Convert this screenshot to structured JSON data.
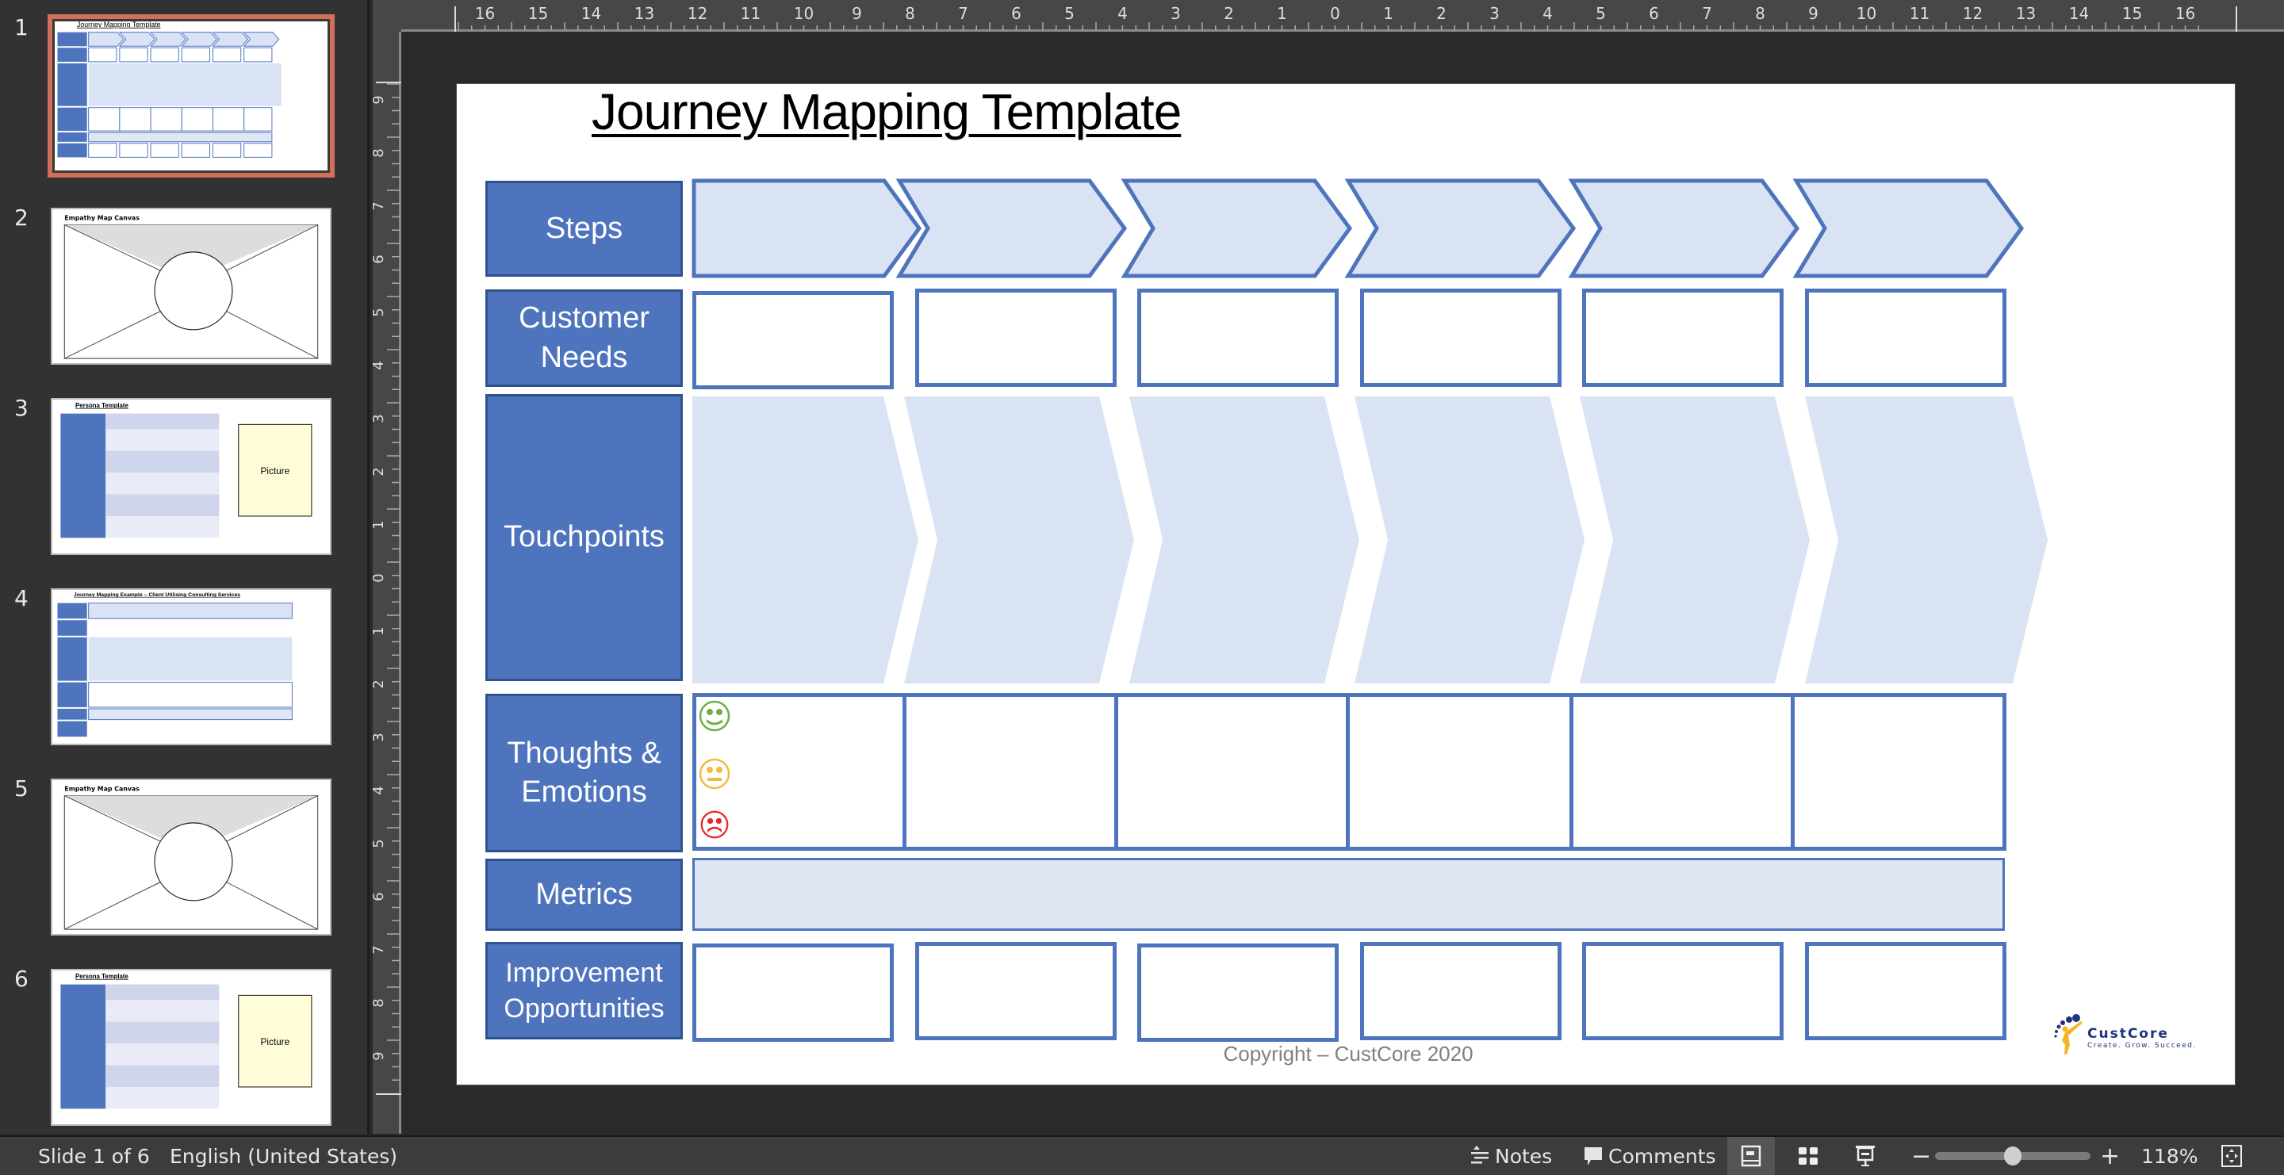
{
  "app": {
    "slide_count": 6,
    "current_slide": 1
  },
  "thumbnails": [
    {
      "number": "1",
      "title": "Journey Mapping Template",
      "selected": true
    },
    {
      "number": "2",
      "title": "Empathy Map Canvas",
      "selected": false
    },
    {
      "number": "3",
      "title": "Persona Template",
      "selected": false,
      "picture_label": "Picture"
    },
    {
      "number": "4",
      "title": "Journey Mapping Example – Client Utilising Consulting Services",
      "selected": false
    },
    {
      "number": "5",
      "title": "Empathy Map Canvas",
      "selected": false
    },
    {
      "number": "6",
      "title": "Persona Template",
      "selected": false,
      "picture_label": "Picture"
    }
  ],
  "ruler": {
    "horizontal_ticks": [
      "16",
      "15",
      "14",
      "13",
      "12",
      "11",
      "10",
      "9",
      "8",
      "7",
      "6",
      "5",
      "4",
      "3",
      "2",
      "1",
      "0",
      "1",
      "2",
      "3",
      "4",
      "5",
      "6",
      "7",
      "8",
      "9",
      "10",
      "11",
      "12",
      "13",
      "14",
      "15",
      "16"
    ],
    "vertical_ticks": [
      "9",
      "8",
      "7",
      "6",
      "5",
      "4",
      "3",
      "2",
      "1",
      "0",
      "1",
      "2",
      "3",
      "4",
      "5",
      "6",
      "7",
      "8",
      "9"
    ]
  },
  "slide": {
    "title": "Journey Mapping Template",
    "row_labels": {
      "steps": "Steps",
      "customer_needs_1": "Customer",
      "customer_needs_2": "Needs",
      "touchpoints": "Touchpoints",
      "thoughts_1": "Thoughts &",
      "thoughts_2": "Emotions",
      "metrics": "Metrics",
      "improvement_1": "Improvement",
      "improvement_2": "Opportunities"
    },
    "step_count": 6,
    "emotion_icons": [
      "happy-face-icon",
      "neutral-face-icon",
      "sad-face-icon"
    ],
    "copyright": "Copyright – CustCore 2020",
    "logo": {
      "name": "CustCore",
      "tagline": "Create. Grow. Succeed."
    }
  },
  "colors": {
    "label_fill": "#4e74be",
    "label_border": "#2f528f",
    "chevron_fill": "#dae3f3",
    "happy": "#70ad47",
    "neutral": "#f4b942",
    "sad": "#e8262a",
    "selected_thumb": "#d0705a"
  },
  "statusbar": {
    "slide_indicator": "Slide 1 of 6",
    "language": "English (United States)",
    "notes": "Notes",
    "comments": "Comments",
    "zoom_minus": "−",
    "zoom_plus": "+",
    "zoom_level": "118%",
    "zoom_slider_fraction": 0.5
  }
}
